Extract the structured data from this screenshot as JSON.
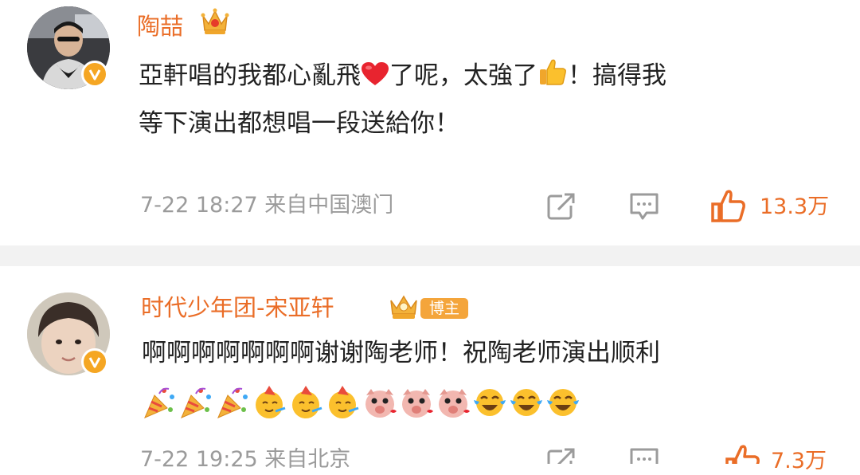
{
  "comments": [
    {
      "username": "陶喆",
      "line1_before": "亞軒唱的我都心亂飛",
      "line1_after": "了呢，太強了",
      "line1_end": "！搞得我",
      "line2": "等下演出都想唱一段送給你！",
      "meta": "7-22 18:27 来自中国澳门",
      "likes": "13.3万",
      "icons": [
        "crown-icon",
        "heart-emoji",
        "thumbs-up-emoji",
        "share-icon",
        "comment-icon",
        "like-icon"
      ]
    },
    {
      "username": "时代少年团-宋亚轩",
      "badge": "博主",
      "line1": "啊啊啊啊啊啊啊谢谢陶老师！祝陶老师演出顺利",
      "meta": "7-22 19:25 来自北京",
      "likes": "7.3万",
      "emojis": [
        "party-popper",
        "party-popper",
        "party-popper",
        "party-face",
        "party-face",
        "party-face",
        "pig-kiss",
        "pig-kiss",
        "pig-kiss",
        "tears-of-joy",
        "tears-of-joy",
        "tears-of-joy"
      ]
    }
  ],
  "colors": {
    "accent": "#ea6d27",
    "meta_gray": "#9b9b9b",
    "separator": "#f2f2f2",
    "badge_bg": "#f4a53b"
  }
}
